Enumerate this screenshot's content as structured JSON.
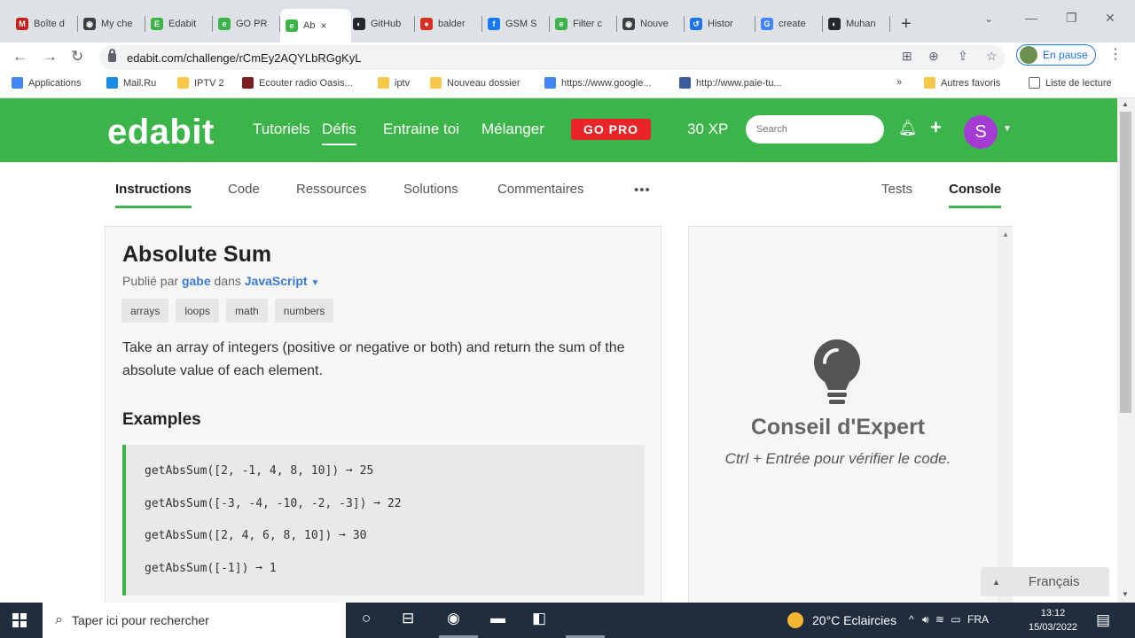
{
  "browser": {
    "tabs": [
      {
        "title": "Boîte d",
        "favicon_color": "#c5221f",
        "favicon_glyph": "M"
      },
      {
        "title": "My che",
        "favicon_color": "#3c4043",
        "favicon_glyph": "◉"
      },
      {
        "title": "Edabit",
        "favicon_color": "#3bb54a",
        "favicon_glyph": "E"
      },
      {
        "title": "GO PR",
        "favicon_color": "#3bb54a",
        "favicon_glyph": "e"
      },
      {
        "title": "Ab",
        "favicon_color": "#3bb54a",
        "favicon_glyph": "e"
      },
      {
        "title": "GitHub",
        "favicon_color": "#24292e",
        "favicon_glyph": "◐"
      },
      {
        "title": "balder",
        "favicon_color": "#d93025",
        "favicon_glyph": "●"
      },
      {
        "title": "GSM S",
        "favicon_color": "#1877f2",
        "favicon_glyph": "f"
      },
      {
        "title": "Filter c",
        "favicon_color": "#3bb54a",
        "favicon_glyph": "e"
      },
      {
        "title": "Nouve",
        "favicon_color": "#3c4043",
        "favicon_glyph": "◉"
      },
      {
        "title": "Histor",
        "favicon_color": "#1a73e8",
        "favicon_glyph": "↺"
      },
      {
        "title": "create",
        "favicon_color": "#4285f4",
        "favicon_glyph": "G"
      },
      {
        "title": "Muhan",
        "favicon_color": "#24292e",
        "favicon_glyph": "◐"
      }
    ],
    "active_tab_close": "×",
    "new_tab": "+",
    "url": "edabit.com/challenge/rCmEy2AQYLbRGgKyL",
    "profile_status": "En pause"
  },
  "bookmarks": [
    {
      "label": "Applications",
      "color": "#4285f4"
    },
    {
      "label": "Mail.Ru",
      "color": "#168de2"
    },
    {
      "label": "IPTV 2",
      "color": "#f9c84a"
    },
    {
      "label": "Ecouter radio Oasis...",
      "color": "#7a1f1f"
    },
    {
      "label": "iptv",
      "color": "#f9c84a"
    },
    {
      "label": "Nouveau dossier",
      "color": "#f9c84a"
    },
    {
      "label": "https://www.google...",
      "color": "#4285f4"
    },
    {
      "label": "http://www.paie-tu...",
      "color": "#3a5ba0"
    }
  ],
  "bookmarks_right": {
    "more": "»",
    "other": "Autres favoris",
    "reading_list": "Liste de lecture"
  },
  "edabit": {
    "logo": "edabit",
    "nav": [
      "Tutoriels",
      "Défis",
      "Entraine toi",
      "Mélanger"
    ],
    "gopro": "GO PRO",
    "xp": "30 XP",
    "search_placeholder": "Search",
    "user_initial": "S",
    "accent": "#3bb54a"
  },
  "challenge_tabs": {
    "left": [
      "Instructions",
      "Code",
      "Ressources",
      "Solutions",
      "Commentaires"
    ],
    "more": "•••",
    "right": [
      "Tests",
      "Console"
    ]
  },
  "challenge": {
    "title": "Absolute Sum",
    "byline_prefix": "Publié par",
    "author": "gabe",
    "byline_mid": "dans",
    "language": "JavaScript",
    "tags": [
      "arrays",
      "loops",
      "math",
      "numbers"
    ],
    "description": "Take an array of integers (positive or negative or both) and return the sum of the absolute value of each element.",
    "examples_heading": "Examples",
    "examples": [
      "getAbsSum([2, -1, 4, 8, 10]) ➞ 25",
      "getAbsSum([-3, -4, -10, -2, -3]) ➞ 22",
      "getAbsSum([2, 4, 6, 8, 10]) ➞ 30",
      "getAbsSum([-1]) ➞ 1"
    ]
  },
  "console_panel": {
    "tip_title": "Conseil d'Expert",
    "tip_sub": "Ctrl + Entrée pour vérifier le code."
  },
  "language_button": "Français",
  "taskbar": {
    "search_placeholder": "Taper ici pour rechercher",
    "weather": "20°C  Eclaircies",
    "lang": "FRA",
    "time": "13:12",
    "date": "15/03/2022"
  }
}
